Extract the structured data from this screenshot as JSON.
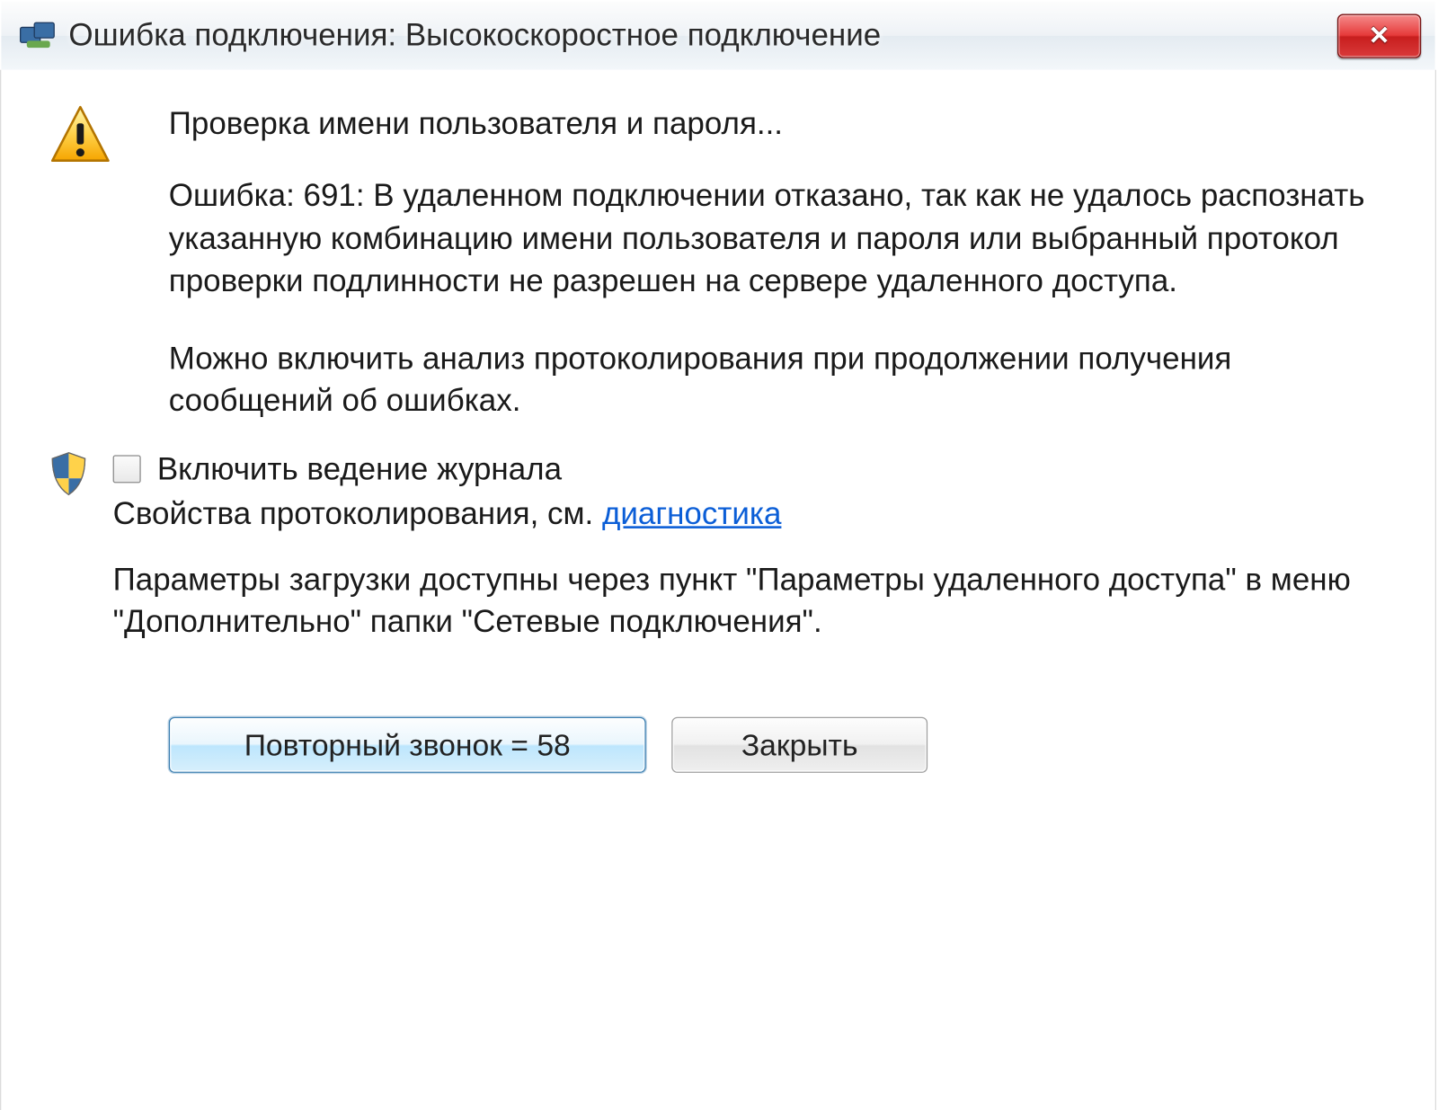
{
  "window": {
    "title": "Ошибка подключения: Высокоскоростное подключение"
  },
  "messages": {
    "checking": "Проверка имени пользователя и пароля...",
    "error": "Ошибка: 691: В удаленном подключении отказано, так как не удалось распознать указанную комбинацию имени пользователя и пароля или выбранный протокол проверки подлинности не разрешен на сервере удаленного доступа.",
    "hint": "Можно включить анализ протоколирования при продолжении получения сообщений об ошибках.",
    "checkbox": "Включить ведение журнала",
    "logging_prefix": "Свойства протоколирования, см. ",
    "logging_link": "диагностика",
    "params": "Параметры загрузки доступны через пункт \"Параметры удаленного доступа\" в меню \"Дополнительно\" папки \"Сетевые подключения\"."
  },
  "buttons": {
    "redial": "Повторный звонок = 58",
    "close": "Закрыть"
  }
}
